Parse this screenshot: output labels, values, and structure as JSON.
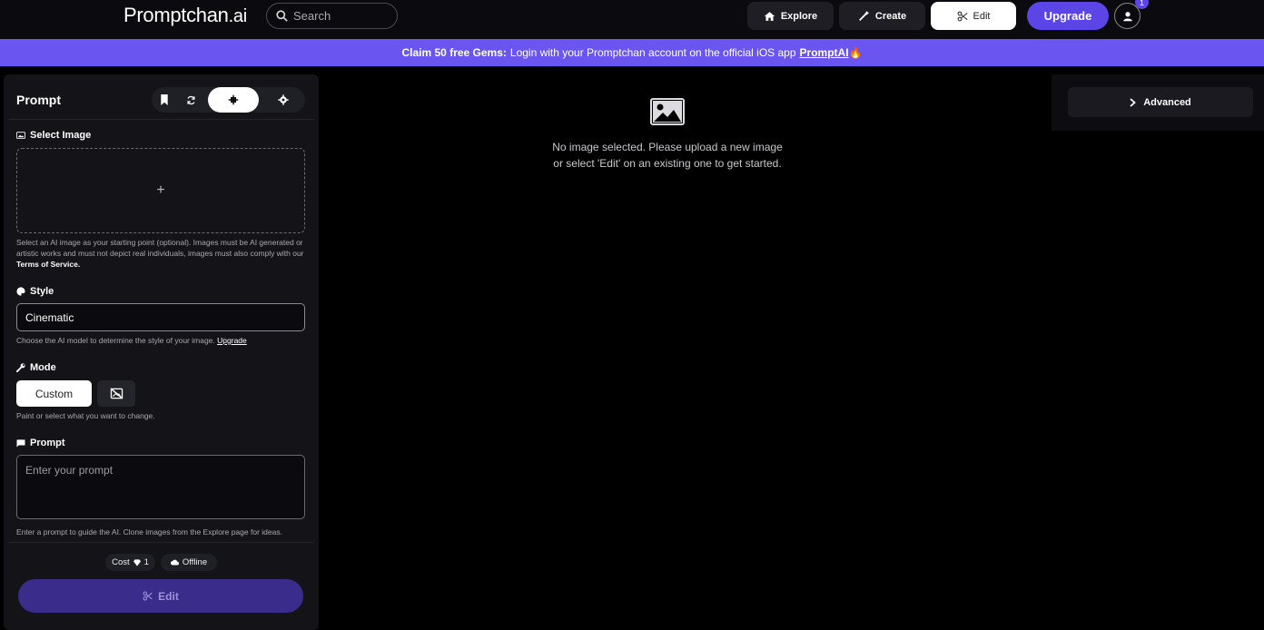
{
  "brand": {
    "logo_main": "Promptchan",
    "logo_suffix": ".ai"
  },
  "search": {
    "placeholder": "Search"
  },
  "nav": {
    "explore": "Explore",
    "create": "Create",
    "edit": "Edit",
    "upgrade": "Upgrade",
    "notification_count": "1"
  },
  "banner": {
    "bold": "Claim 50 free Gems:",
    "text": "Login with your Promptchan account on the official iOS app",
    "link": "PromptAI",
    "emoji": "🔥"
  },
  "panel": {
    "title": "Prompt",
    "select_image": {
      "label": "Select Image",
      "plus": "+",
      "help_1": "Select an AI image as your starting point (optional). Images must be AI generated or artistic works and must not depict real individuals, images must also comply with our",
      "help_link": "Terms of Service."
    },
    "style": {
      "label": "Style",
      "value": "Cinematic",
      "help": "Choose the AI model to determine the style of your image.",
      "help_link": "Upgrade"
    },
    "mode": {
      "label": "Mode",
      "custom": "Custom",
      "help": "Paint or select what you want to change."
    },
    "prompt": {
      "label": "Prompt",
      "placeholder": "Enter your prompt",
      "help": "Enter a prompt to guide the AI. Clone images from the Explore page for ideas."
    },
    "cost_label": "Cost",
    "cost_value": "1",
    "status": "Offline",
    "edit_button": "Edit"
  },
  "empty_state": {
    "line1": "No image selected. Please upload a new image",
    "line2": "or select 'Edit' on an existing one to get started."
  },
  "right": {
    "advanced": "Advanced"
  }
}
